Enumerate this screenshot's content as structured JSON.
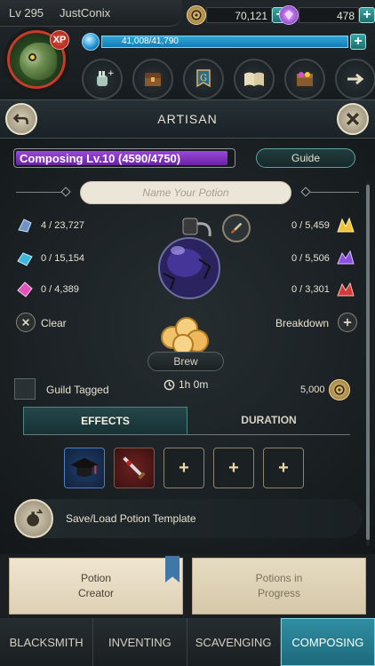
{
  "player": {
    "level": "Lv 295",
    "name": "JustConix",
    "xp_badge": "XP"
  },
  "currencies": [
    {
      "name": "gold",
      "value": "70,121",
      "color": "#c9a45a"
    },
    {
      "name": "gems",
      "value": "478",
      "color": "#a259e0"
    }
  ],
  "energy": {
    "value": "41,008/41,790"
  },
  "header": {
    "title": "ARTISAN"
  },
  "composing": {
    "label": "Composing Lv.10 (4590/4750)",
    "progress": 0.966
  },
  "guide_label": "Guide",
  "name_input": {
    "placeholder": "Name Your Potion"
  },
  "ingredients_left": [
    {
      "icon": "crystal-blue-icon",
      "value": "4 / 23,727"
    },
    {
      "icon": "crystal-cyan-icon",
      "value": "0 / 15,154"
    },
    {
      "icon": "crystal-pink-icon",
      "value": "0 / 4,389"
    }
  ],
  "ingredients_right": [
    {
      "icon": "crystal-gold-icon",
      "value": "0 / 5,459"
    },
    {
      "icon": "crystal-purple-icon",
      "value": "0 / 5,506"
    },
    {
      "icon": "crystal-red-icon",
      "value": "0 / 3,301"
    }
  ],
  "actions": {
    "clear": "Clear",
    "breakdown": "Breakdown",
    "brew": "Brew",
    "brew_time": "1h 0m"
  },
  "guild": {
    "label": "Guild Tagged",
    "cost": "5,000"
  },
  "tabs": [
    {
      "label": "EFFECTS",
      "active": true
    },
    {
      "label": "DURATION",
      "active": false
    }
  ],
  "template": {
    "label": "Save/Load Potion Template"
  },
  "paper_tabs": [
    {
      "label": "Potion\nCreator",
      "active": true
    },
    {
      "label": "Potions in\nProgress",
      "active": false
    }
  ],
  "bottom_nav": [
    {
      "label": "BLACKSMITH",
      "active": false
    },
    {
      "label": "INVENTING",
      "active": false
    },
    {
      "label": "SCAVENGING",
      "active": false
    },
    {
      "label": "COMPOSING",
      "active": true
    }
  ]
}
